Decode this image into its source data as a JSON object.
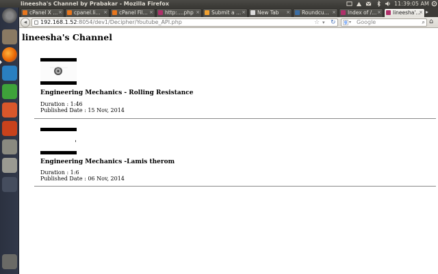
{
  "window": {
    "title": "lineesha's Channel by Prabakar - Mozilla Firefox",
    "clock": "11:39:05 AM"
  },
  "tabs": [
    {
      "label": "cPanel X ...",
      "favicon_color": "#e8761d"
    },
    {
      "label": "cpanel.li...",
      "favicon_color": "#e8761d"
    },
    {
      "label": "cPanel Fil...",
      "favicon_color": "#e8761d"
    },
    {
      "label": "http:....php",
      "favicon_color": "#b0306a"
    },
    {
      "label": "Submit a ...",
      "favicon_color": "#f0a030"
    },
    {
      "label": "New Tab",
      "favicon_color": "#dddddd"
    },
    {
      "label": "Roundcu...",
      "favicon_color": "#3b6ea5"
    },
    {
      "label": "Index of /...",
      "favicon_color": "#b0306a"
    },
    {
      "label": "lineesha'...",
      "favicon_color": "#b0306a",
      "active": true
    }
  ],
  "navbar": {
    "url_host": "192.168.1.52",
    "url_rest": ":8054/dev1/Decipher/Youtube_API.php",
    "search_placeholder": "Google"
  },
  "page": {
    "channel_title": "lineesha's Channel",
    "videos": [
      {
        "title": "Engineering Mechanics - Rolling Resistance",
        "duration": "Duration : 1:46",
        "published": "Published Date : 15 Nov, 2014"
      },
      {
        "title": "Engineering Mechanics -Lamis therom",
        "duration": "Duration : 1:6",
        "published": "Published Date : 06 Nov, 2014"
      }
    ]
  },
  "launcher": [
    {
      "name": "dash-home-icon",
      "color": "#6f6f6f"
    },
    {
      "name": "files-icon",
      "color": "#8a7a63"
    },
    {
      "name": "firefox-icon",
      "color": "#e66000"
    },
    {
      "name": "libreoffice-writer-icon",
      "color": "#2a7fc0"
    },
    {
      "name": "libreoffice-calc-icon",
      "color": "#3ea33a"
    },
    {
      "name": "libreoffice-impress-icon",
      "color": "#d9572b"
    },
    {
      "name": "system-settings-icon",
      "color": "#c8421c"
    },
    {
      "name": "text-editor-icon",
      "color": "#8a8a80"
    },
    {
      "name": "drive-icon",
      "color": "#9a9a92"
    },
    {
      "name": "workspace-switcher-icon",
      "color": "#454d5e"
    },
    {
      "name": "trash-icon",
      "color": "#6a6a66"
    }
  ]
}
